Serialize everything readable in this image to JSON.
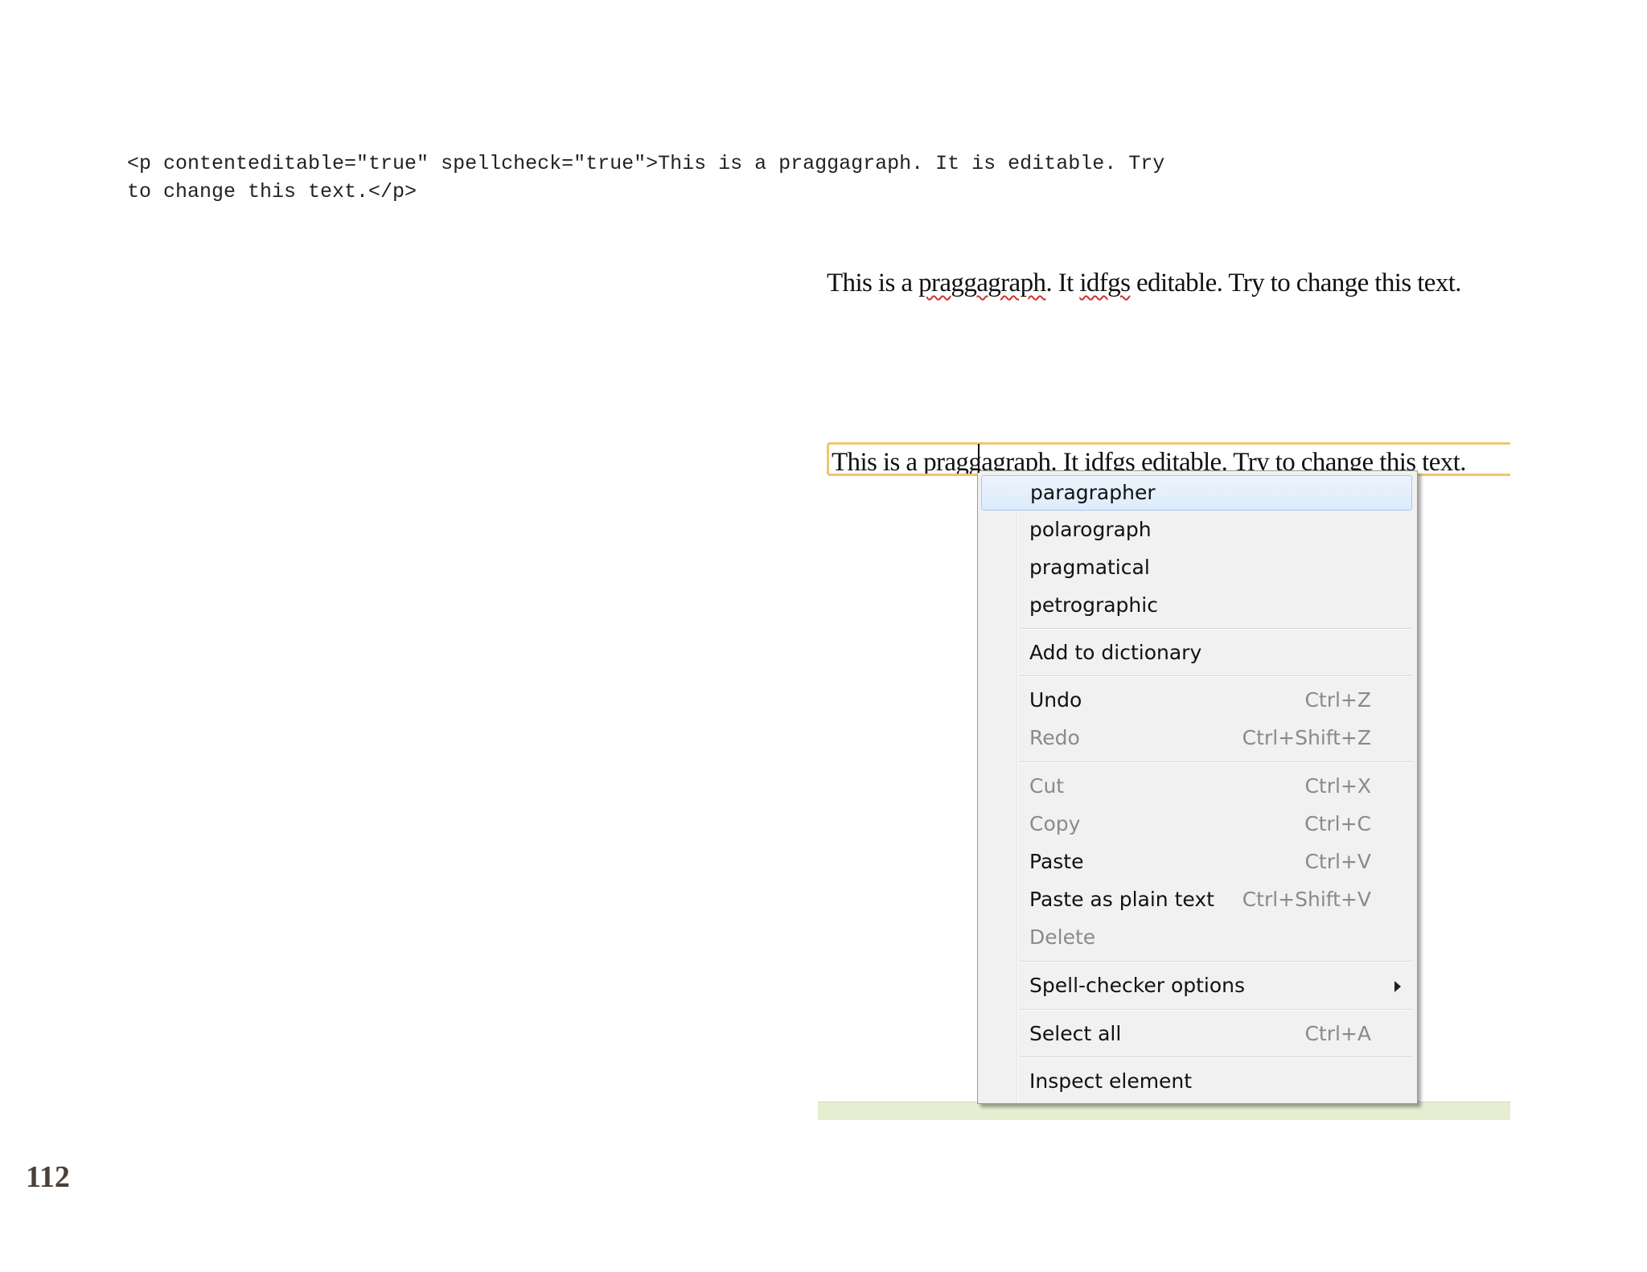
{
  "code": {
    "line1": "<p contenteditable=\"true\" spellcheck=\"true\">This is a praggagraph. It is editable. Try",
    "line2": "to change this text.</p>"
  },
  "rendered_paragraph": {
    "seg1": "This is a ",
    "misspelled1": "praggagraph",
    "seg2": ". It ",
    "misspelled2": "idfgs",
    "seg3": " editable. Try to change this text."
  },
  "editable_paragraph": {
    "text": "This is a praggagraph. It idfgs editable. Try to change this text."
  },
  "context_menu": {
    "suggestions": [
      "paragrapher",
      "polarograph",
      "pragmatical",
      "petrographic"
    ],
    "add_to_dictionary": "Add to dictionary",
    "undo": {
      "label": "Undo",
      "shortcut": "Ctrl+Z"
    },
    "redo": {
      "label": "Redo",
      "shortcut": "Ctrl+Shift+Z"
    },
    "cut": {
      "label": "Cut",
      "shortcut": "Ctrl+X"
    },
    "copy": {
      "label": "Copy",
      "shortcut": "Ctrl+C"
    },
    "paste": {
      "label": "Paste",
      "shortcut": "Ctrl+V"
    },
    "paste_plain": {
      "label": "Paste as plain text",
      "shortcut": "Ctrl+Shift+V"
    },
    "delete": {
      "label": "Delete"
    },
    "spell_options": {
      "label": "Spell-checker options"
    },
    "select_all": {
      "label": "Select all",
      "shortcut": "Ctrl+A"
    },
    "inspect": {
      "label": "Inspect element"
    }
  },
  "page_number": "112",
  "colors": {
    "focus_border": "#f0c670",
    "highlight": "#dcebfc",
    "spell_underline": "#d03030"
  }
}
